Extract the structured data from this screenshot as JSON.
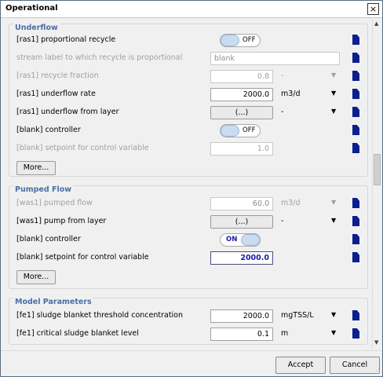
{
  "window": {
    "title": "Operational",
    "close_glyph": "×"
  },
  "underflow": {
    "title": "Underflow",
    "rows": [
      {
        "label": "[ras1] proportional recycle",
        "toggle": "OFF"
      },
      {
        "label": "stream label to which recycle is proportional",
        "value": "blank"
      },
      {
        "label": "[ras1] recycle fraction",
        "value": "0.8",
        "unit": "-"
      },
      {
        "label": "[ras1] underflow rate",
        "value": "2000.0",
        "unit": "m3/d"
      },
      {
        "label": "[ras1] underflow from layer",
        "button": "(...)",
        "unit": "-"
      },
      {
        "label": "[blank] controller",
        "toggle": "OFF"
      },
      {
        "label": "[blank] setpoint for control variable",
        "value": "1.0"
      }
    ],
    "more": "More..."
  },
  "pumped": {
    "title": "Pumped Flow",
    "rows": [
      {
        "label": "[was1] pumped flow",
        "value": "60.0",
        "unit": "m3/d"
      },
      {
        "label": "[was1] pump from layer",
        "button": "(...)",
        "unit": "-"
      },
      {
        "label": "[blank] controller",
        "toggle": "ON"
      },
      {
        "label": "[blank] setpoint for control variable",
        "value": "2000.0"
      }
    ],
    "more": "More..."
  },
  "model": {
    "title": "Model Parameters",
    "rows": [
      {
        "label": "[fe1] sludge blanket threshold concentration",
        "value": "2000.0",
        "unit": "mgTSS/L"
      },
      {
        "label": "[fe1] critical sludge blanket level",
        "value": "0.1",
        "unit": "m"
      }
    ]
  },
  "footer": {
    "accept": "Accept",
    "cancel": "Cancel"
  },
  "icons": {
    "doc": "document-icon",
    "dropdown": "▼"
  },
  "colors": {
    "accent": "#4a6fa5",
    "doc_icon": "#0b1f8f",
    "bold_value": "#1a1aa8"
  }
}
